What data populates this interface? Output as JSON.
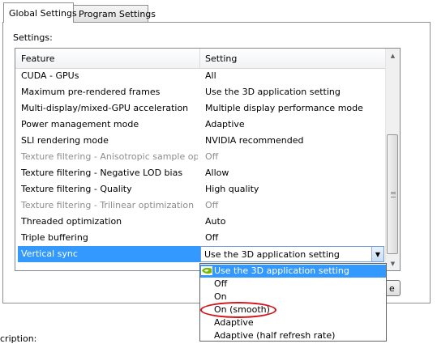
{
  "tabs": [
    {
      "label": "Global Settings",
      "active": true
    },
    {
      "label": "Program Settings",
      "active": false
    }
  ],
  "settings_label": "Settings:",
  "list": {
    "headers": {
      "feature": "Feature",
      "setting": "Setting"
    },
    "rows": [
      {
        "feature": "CUDA - GPUs",
        "setting": "All",
        "disabled": false
      },
      {
        "feature": "Maximum pre-rendered frames",
        "setting": "Use the 3D application setting",
        "disabled": false
      },
      {
        "feature": "Multi-display/mixed-GPU acceleration",
        "setting": "Multiple display performance mode",
        "disabled": false
      },
      {
        "feature": "Power management mode",
        "setting": "Adaptive",
        "disabled": false
      },
      {
        "feature": "SLI rendering mode",
        "setting": "NVIDIA recommended",
        "disabled": false
      },
      {
        "feature": "Texture filtering - Anisotropic sample opti...",
        "setting": "Off",
        "disabled": true
      },
      {
        "feature": "Texture filtering - Negative LOD bias",
        "setting": "Allow",
        "disabled": false
      },
      {
        "feature": "Texture filtering - Quality",
        "setting": "High quality",
        "disabled": false
      },
      {
        "feature": "Texture filtering - Trilinear optimization",
        "setting": "Off",
        "disabled": true
      },
      {
        "feature": "Threaded optimization",
        "setting": "Auto",
        "disabled": false
      },
      {
        "feature": "Triple buffering",
        "setting": "Off",
        "disabled": false
      }
    ],
    "selected_row": {
      "feature": "Vertical sync",
      "setting": "Use the 3D application setting"
    }
  },
  "dropdown": {
    "options": [
      {
        "label": "Use the 3D application setting",
        "highlighted": true,
        "icon": "nvidia-icon"
      },
      {
        "label": "Off",
        "highlighted": false
      },
      {
        "label": "On",
        "highlighted": false
      },
      {
        "label": "On (smooth)",
        "highlighted": false,
        "circled": true
      },
      {
        "label": "Adaptive",
        "highlighted": false
      },
      {
        "label": "Adaptive (half refresh rate)",
        "highlighted": false
      }
    ]
  },
  "restore_button_fragment": "e",
  "description_label": "cription:",
  "colors": {
    "selection": "#3399ff",
    "annotation_circle": "#d3121a",
    "nvidia_green": "#76b900"
  }
}
